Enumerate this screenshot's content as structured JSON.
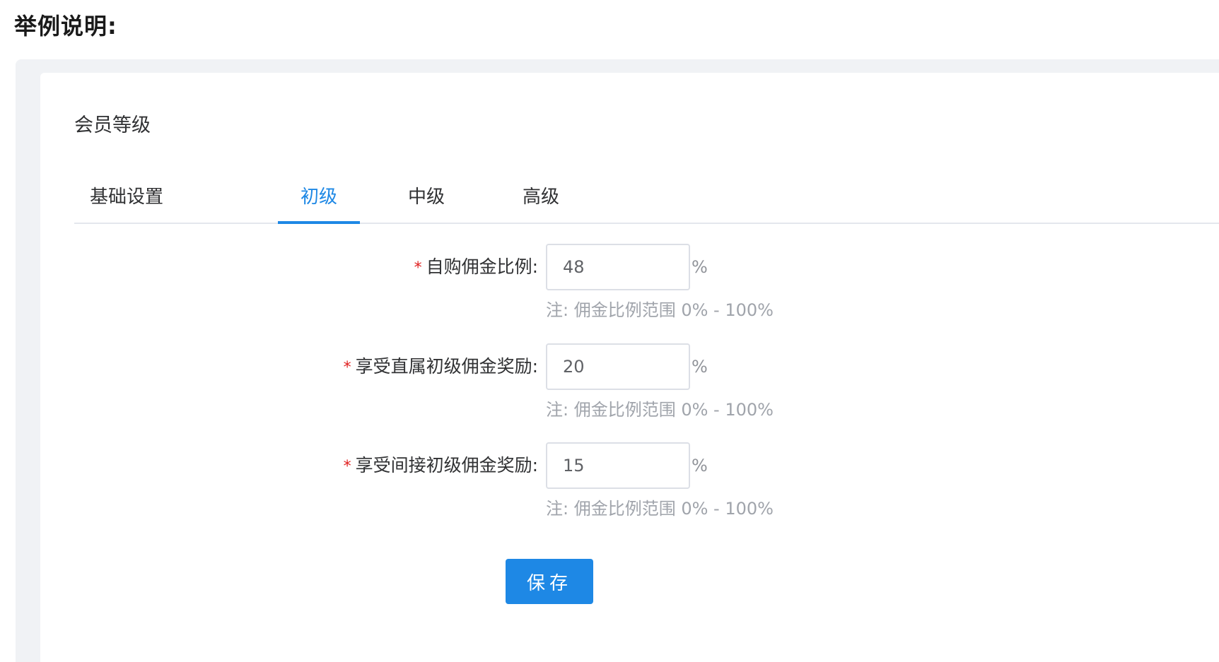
{
  "page": {
    "heading": "举例说明:"
  },
  "card": {
    "title": "会员等级"
  },
  "tabs": [
    {
      "label": "基础设置",
      "active": false
    },
    {
      "label": "初级",
      "active": true
    },
    {
      "label": "中级",
      "active": false
    },
    {
      "label": "高级",
      "active": false
    }
  ],
  "form": {
    "fields": [
      {
        "required": "*",
        "label": "自购佣金比例:",
        "value": "48",
        "unit": "%",
        "note": "注: 佣金比例范围 0% - 100%"
      },
      {
        "required": "*",
        "label": "享受直属初级佣金奖励:",
        "value": "20",
        "unit": "%",
        "note": "注: 佣金比例范围 0% - 100%"
      },
      {
        "required": "*",
        "label": "享受间接初级佣金奖励:",
        "value": "15",
        "unit": "%",
        "note": "注: 佣金比例范围 0% - 100%"
      }
    ],
    "save_label": "保存"
  },
  "colors": {
    "accent": "#1e88e5",
    "required": "#e02020",
    "background": "#f0f2f5"
  }
}
